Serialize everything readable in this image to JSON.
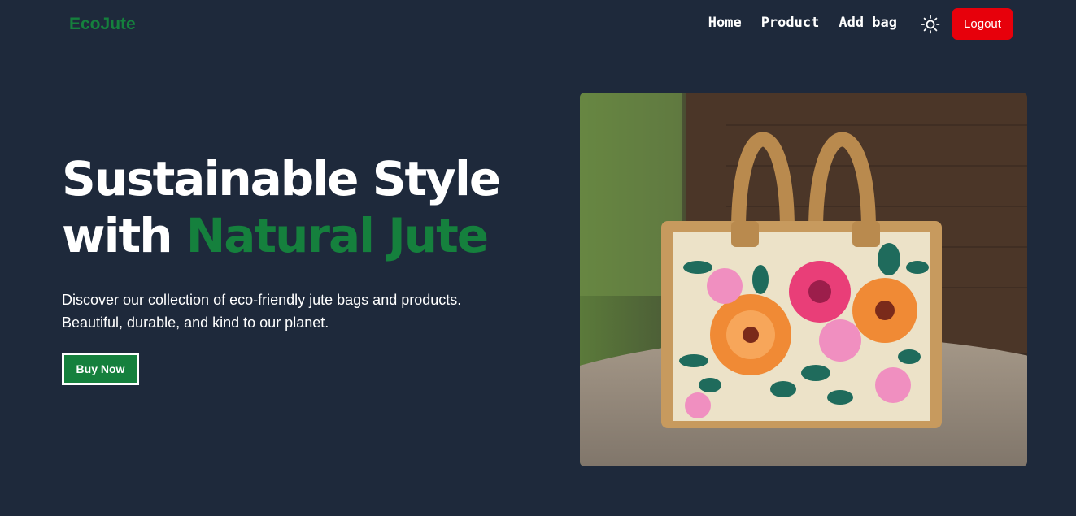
{
  "nav": {
    "logo": "EcoJute",
    "links": [
      "Home",
      "Product",
      "Add bag"
    ],
    "theme_icon": "sun-icon",
    "logout_label": "Logout",
    "colors": {
      "brand": "#15803d",
      "logout": "#e7000b",
      "background": "#1e293b"
    }
  },
  "hero": {
    "headline_line1": "Sustainable Style",
    "headline_line2_plain": "with",
    "headline_line2_accent": "Natural Jute",
    "description_line1": "Discover our collection of eco-friendly jute bags and products.",
    "description_line2": "Beautiful, durable, and kind to our planet.",
    "cta_label": "Buy Now",
    "image_subject": "floral-jute-tote-bag-photo"
  }
}
